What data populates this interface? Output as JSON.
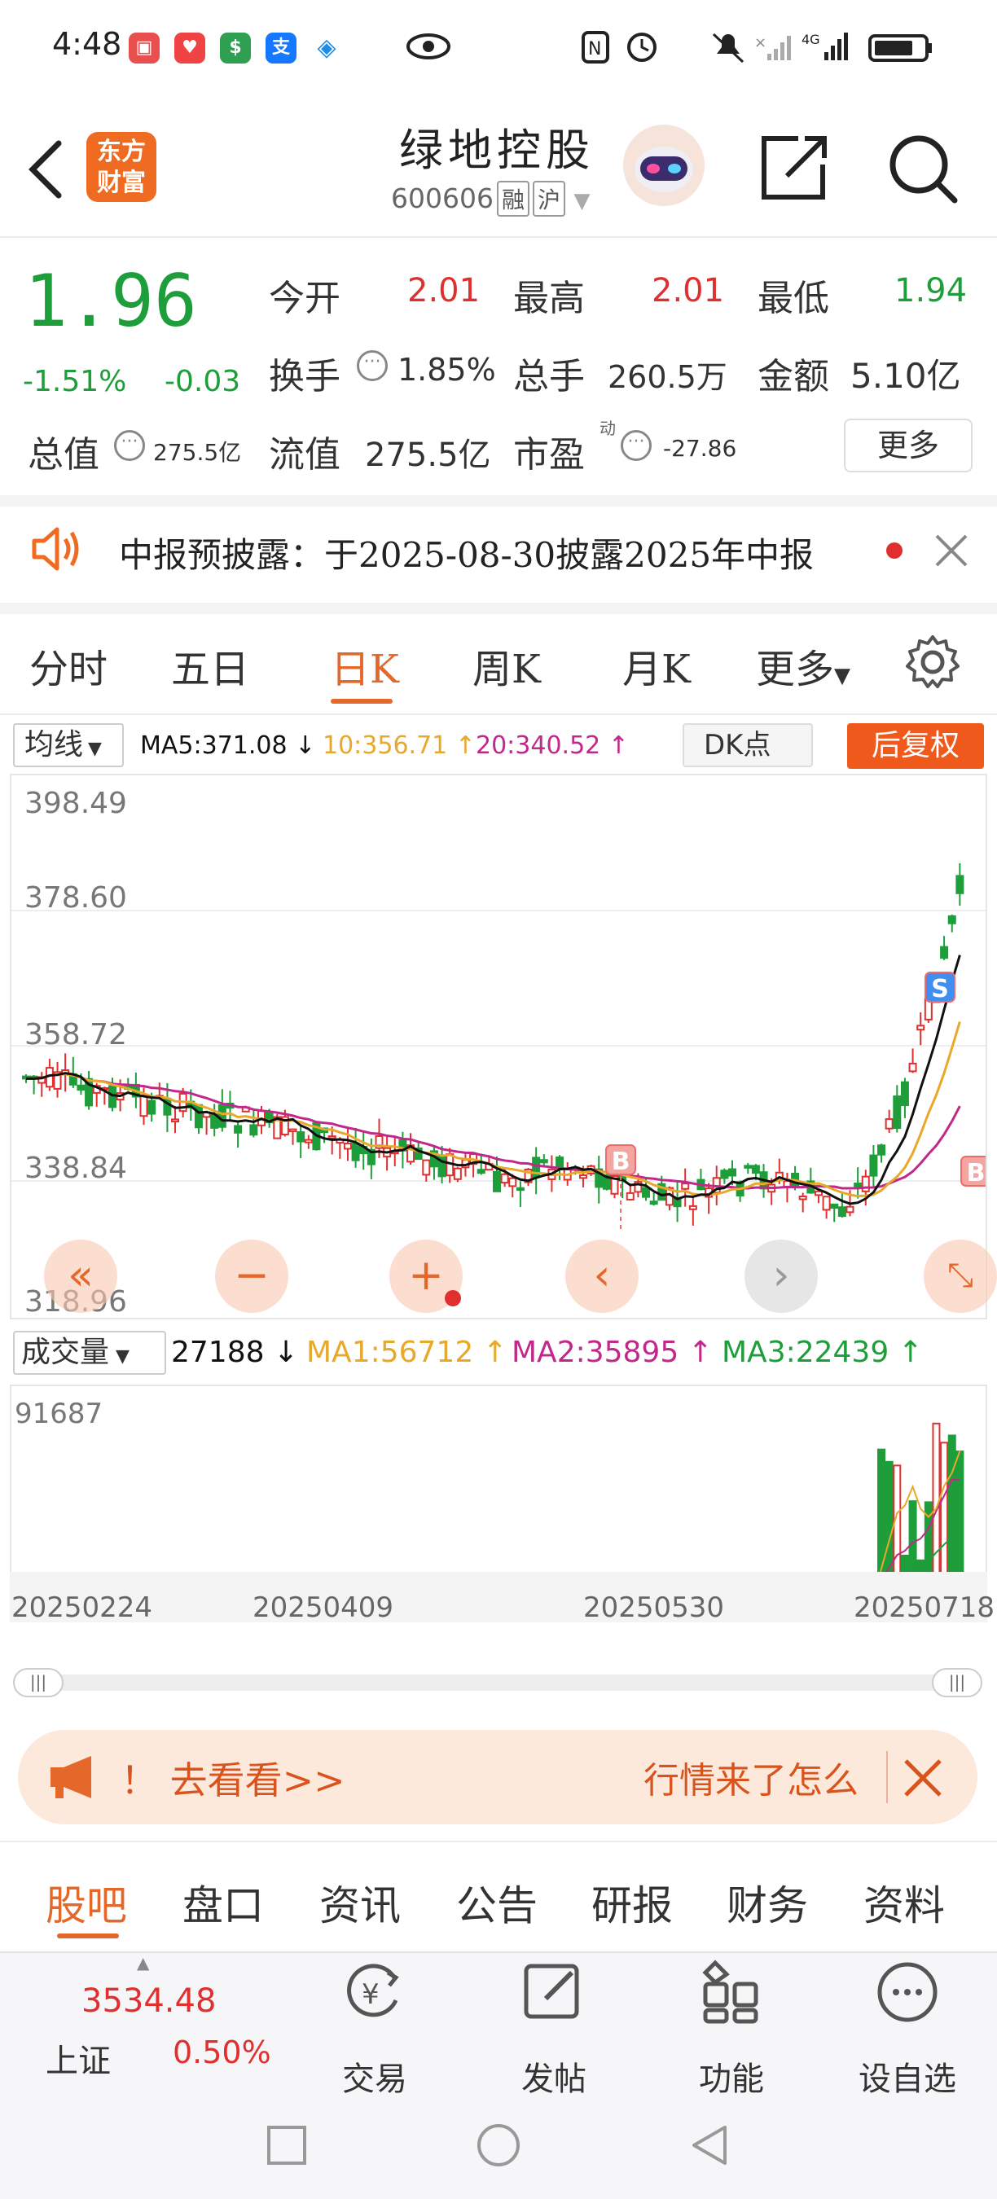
{
  "status": {
    "time": "4:48",
    "network": "4G"
  },
  "header": {
    "title": "绿地控股",
    "code": "600606",
    "tag1": "融",
    "tag2": "沪",
    "logo_line1": "东方",
    "logo_line2": "财富"
  },
  "quote": {
    "price": "1.96",
    "change_pct": "-1.51%",
    "change": "-0.03",
    "open_label": "今开",
    "open": "2.01",
    "high_label": "最高",
    "high": "2.01",
    "low_label": "最低",
    "low": "1.94",
    "turnover_label": "换手",
    "turnover": "1.85%",
    "volume_label": "总手",
    "volume": "260.5万",
    "amount_label": "金额",
    "amount": "5.10亿",
    "mktcap_label": "总值",
    "mktcap": "275.5亿",
    "float_label": "流值",
    "float": "275.5亿",
    "pe_label": "市盈",
    "pe_sup": "动",
    "pe": "-27.86",
    "more": "更多"
  },
  "notice": {
    "text": "中报预披露：于2025-08-30披露2025年中报"
  },
  "period_tabs": [
    {
      "label": "分时"
    },
    {
      "label": "五日"
    },
    {
      "label": "日K"
    },
    {
      "label": "周K"
    },
    {
      "label": "月K"
    },
    {
      "label": "更多"
    }
  ],
  "ma_bar": {
    "selector": "均线",
    "ma5": "MA5:371.08",
    "ma10": "10:356.71",
    "ma20": "20:340.52",
    "dk": "DK点",
    "fuquan": "后复权"
  },
  "kline_axis": {
    "labels": [
      "398.49",
      "378.60",
      "358.72",
      "338.84",
      "318.96"
    ]
  },
  "vol_bar": {
    "selector": "成交量",
    "vol": "27188",
    "ma1": "MA1:56712",
    "ma2": "MA2:35895",
    "ma3": "MA3:22439",
    "max": "91687"
  },
  "dates": [
    "20250224",
    "20250409",
    "20250530",
    "20250718"
  ],
  "ad": {
    "text": "！ 去看看>>",
    "right": "行情来了怎么"
  },
  "bottom_tabs": [
    {
      "label": "股吧"
    },
    {
      "label": "盘口"
    },
    {
      "label": "资讯"
    },
    {
      "label": "公告"
    },
    {
      "label": "研报"
    },
    {
      "label": "财务"
    },
    {
      "label": "资料"
    }
  ],
  "index": {
    "value": "3534.48",
    "name": "上证",
    "pct": "0.50%"
  },
  "nav": [
    {
      "label": "交易"
    },
    {
      "label": "发帖"
    },
    {
      "label": "功能"
    },
    {
      "label": "设自选"
    }
  ],
  "colors": {
    "red": "#e02f2f",
    "green": "#1e9e3a",
    "brand": "#ef6b21",
    "ma5": "#111111",
    "ma10": "#e8a82a",
    "ma20": "#c2278a"
  },
  "chart_data": {
    "type": "candlestick",
    "ylim": [
      318.96,
      398.49
    ],
    "markers": [
      {
        "label": "B"
      },
      {
        "label": "S"
      },
      {
        "label": "B"
      }
    ],
    "volume_ylim": [
      0,
      91687
    ]
  }
}
